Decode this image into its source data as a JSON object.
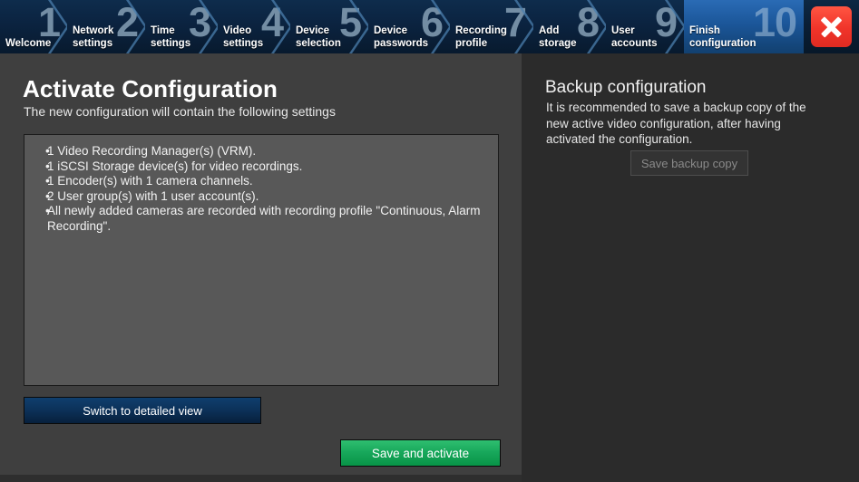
{
  "window": {
    "close_label": "×"
  },
  "wizard": {
    "active_step": 10,
    "steps": [
      {
        "number": "1",
        "label": "Welcome"
      },
      {
        "number": "2",
        "label": "Network\nsettings"
      },
      {
        "number": "3",
        "label": "Time\nsettings"
      },
      {
        "number": "4",
        "label": "Video\nsettings"
      },
      {
        "number": "5",
        "label": "Device\nselection"
      },
      {
        "number": "6",
        "label": "Device\npasswords"
      },
      {
        "number": "7",
        "label": "Recording\nprofile"
      },
      {
        "number": "8",
        "label": "Add\nstorage"
      },
      {
        "number": "9",
        "label": "User\naccounts"
      },
      {
        "number": "10",
        "label": "Finish\nconfiguration"
      }
    ]
  },
  "main": {
    "title": "Activate Configuration",
    "subtitle": "The new configuration will contain the following settings",
    "summary_items": [
      "1 Video Recording Manager(s) (VRM).",
      "1 iSCSI Storage device(s) for video recordings.",
      "1 Encoder(s) with 1 camera channels.",
      "2 User group(s) with 1 user account(s).",
      "All newly added cameras are recorded with recording profile \"Continuous, Alarm Recording\"."
    ],
    "switch_view_label": "Switch to detailed view",
    "save_activate_label": "Save and activate"
  },
  "backup": {
    "title": "Backup configuration",
    "description": "It is recommended to save a backup copy of the new active video configuration, after having activated the configuration.",
    "save_backup_label": "Save backup copy"
  },
  "colors": {
    "header_blue": "#0b2340",
    "active_step_blue": "#1b5699",
    "close_red": "#f0342a",
    "activate_green": "#18a85c",
    "left_panel": "#3f3f3f",
    "right_panel": "#2b2b2b",
    "summary_box": "#585858"
  }
}
